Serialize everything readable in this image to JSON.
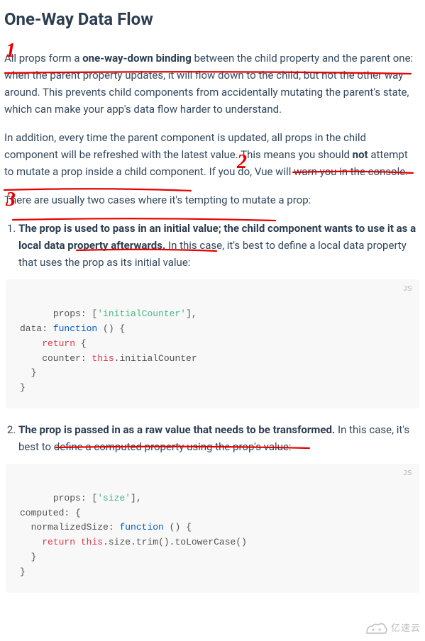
{
  "heading": "One-Way Data Flow",
  "annotations": {
    "mark1": "1",
    "mark2": "2",
    "mark3": "3"
  },
  "para1": {
    "s1_pre": "All props form a ",
    "s1_bold": "one-way-down binding",
    "s1_post": " between the child property and the parent one: when the parent property updates, it will flow down to the child, but not the other way around. This prevents child components from accidentally mutating the parent's state, which can make your app's data flow harder to understand."
  },
  "para2": {
    "s1": "In addition, every time the parent component is updated, all props in the child component will be refreshed with the latest value. This means you should ",
    "s1_bold": "not",
    "s2": " attempt to mutate a prop inside a child component. If you do, Vue will warn you in the console."
  },
  "para3": "There are usually two cases where it's tempting to mutate a prop:",
  "list": {
    "item1": {
      "bold": "The prop is used to pass in an initial value; the child component wants to use it as a local data property afterwards.",
      "rest": " In this case, it's best to define a local data property that uses the prop as its initial value:"
    },
    "item2": {
      "bold": "The prop is passed in as a raw value that needs to be transformed.",
      "rest": " In this case, it's best to define a computed property using the prop's value:"
    }
  },
  "code": {
    "lang": "JS",
    "block1": {
      "l1a": "props: [",
      "l1b": "'initialCounter'",
      "l1c": "],",
      "l2a": "data: ",
      "l2b": "function",
      "l2c": " () {",
      "l3a": "    ",
      "l3b": "return",
      "l3c": " {",
      "l4a": "    counter: ",
      "l4b": "this",
      "l4c": ".initialCounter",
      "l5": "  }",
      "l6": "}"
    },
    "block2": {
      "l1a": "props: [",
      "l1b": "'size'",
      "l1c": "],",
      "l2": "computed: {",
      "l3a": "  normalizedSize: ",
      "l3b": "function",
      "l3c": " () {",
      "l4a": "    ",
      "l4b": "return",
      "l4c": " ",
      "l4d": "this",
      "l4e": ".size.trim().toLowerCase()",
      "l5": "  }",
      "l6": "}"
    }
  },
  "watermark": "亿速云"
}
